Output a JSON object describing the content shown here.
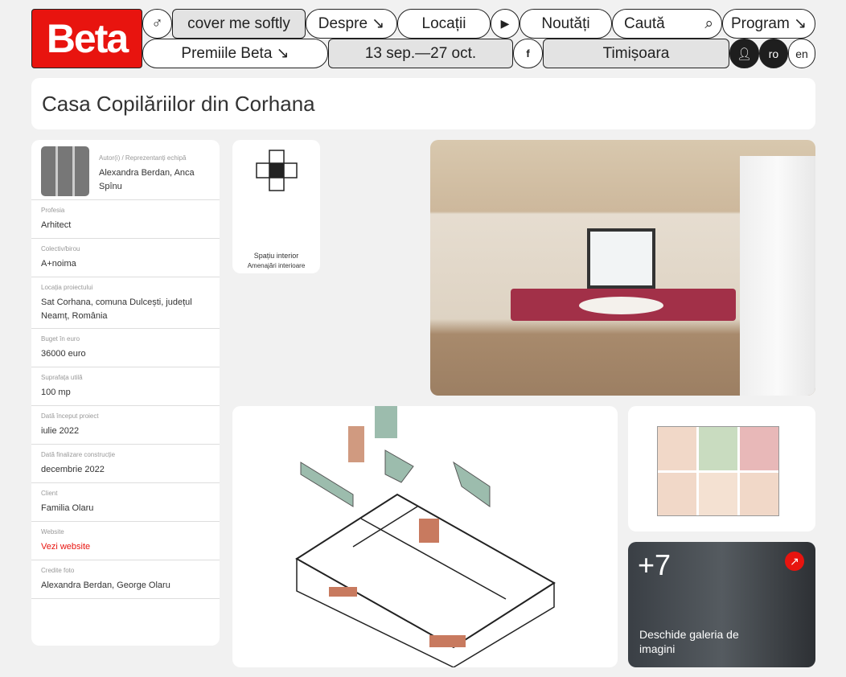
{
  "nav": {
    "logo": "Beta",
    "search_mode": "cover me softly",
    "despre": "Despre ↘",
    "locatii": "Locații",
    "noutati": "Noutăți",
    "cauta": "Caută",
    "program": "Program ↘",
    "premii": "Premiile Beta ↘",
    "dates": "13 sep.—27 oct.",
    "facebook": "f",
    "city": "Timișoara",
    "lang_ro": "ro",
    "lang_en": "en"
  },
  "page": {
    "title": "Casa Copilăriilor din Corhana"
  },
  "details": [
    {
      "label": "Autor(i) / Reprezentanți echipă",
      "value": "Alexandra Berdan, Anca Spînu"
    },
    {
      "label": "Profesia",
      "value": "Arhitect"
    },
    {
      "label": "Colectiv/birou",
      "value": "A+noima"
    },
    {
      "label": "Locația proiectului",
      "value": "Sat Corhana, comuna Dulcești, județul Neamț, România"
    },
    {
      "label": "Buget în euro",
      "value": "36000 euro"
    },
    {
      "label": "Suprafața utilă",
      "value": "100 mp"
    },
    {
      "label": "Dată început proiect",
      "value": "iulie 2022"
    },
    {
      "label": "Dată finalizare construcție",
      "value": "decembrie 2022"
    },
    {
      "label": "Client",
      "value": "Familia Olaru"
    },
    {
      "label": "Website",
      "value": "Vezi website"
    },
    {
      "label": "Credite foto",
      "value": "Alexandra Berdan, George Olaru"
    }
  ],
  "category": {
    "title": "Spațiu interior",
    "subtitle": "Amenajări interioare"
  },
  "gallery": {
    "count": "+7",
    "open_label": "Deschide galeria de imagini"
  },
  "colors": {
    "brand": "#e8140f"
  }
}
